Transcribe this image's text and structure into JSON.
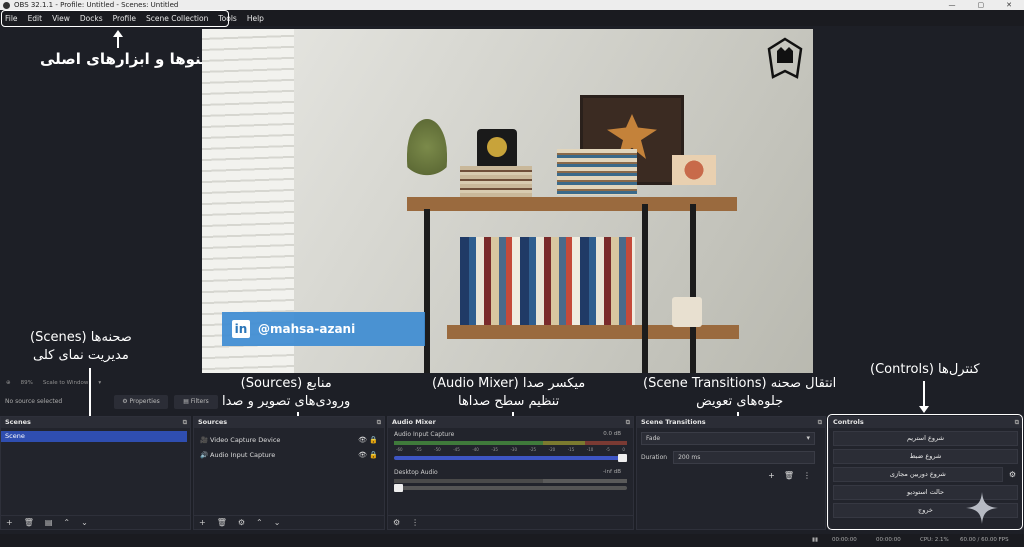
{
  "window": {
    "title": "OBS 32.1.1 - Profile: Untitled - Scenes: Untitled",
    "controls": [
      "—",
      "▢",
      "✕"
    ]
  },
  "menu": [
    "File",
    "Edit",
    "View",
    "Docks",
    "Profile",
    "Scene Collection",
    "Tools",
    "Help"
  ],
  "annotations": {
    "menu": "منوها و ابزارهای اصلی",
    "scenes": [
      "صحنه‌ها (Scenes)",
      "مدیریت نمای کلی"
    ],
    "sources": [
      "منابع (Sources)",
      "ورودی‌های تصویر و صدا"
    ],
    "mixer": [
      "میکسر صدا (Audio Mixer)",
      "تنظیم سطح صداها"
    ],
    "transitions": [
      "انتقال صحنه (Scene Transitions)",
      "جلوه‌های تعویض"
    ],
    "controls": "کنترل‌ها (Controls)"
  },
  "preview": {
    "overlay_handle": "@mahsa-azani",
    "overlay_icon": "in"
  },
  "status_row": [
    "⊕",
    "89%",
    "Scale to Window",
    "▾"
  ],
  "props_row": {
    "no_source": "No source selected",
    "properties": "⚙ Properties",
    "filters": "▤ Filters"
  },
  "scenes": {
    "title": "Scenes",
    "items": [
      "Scene"
    ]
  },
  "sources": {
    "title": "Sources",
    "items": [
      {
        "icon": "🎥",
        "name": "Video Capture Device"
      },
      {
        "icon": "🔊",
        "name": "Audio Input Capture"
      }
    ]
  },
  "mixer": {
    "title": "Audio Mixer",
    "channels": [
      {
        "name": "Audio Input Capture",
        "level": "0.0 dB",
        "active": true
      },
      {
        "name": "Desktop Audio",
        "level": "-inf dB",
        "active": false
      }
    ],
    "ticks": [
      "-60",
      "-55",
      "-50",
      "-45",
      "-40",
      "-35",
      "-30",
      "-25",
      "-20",
      "-15",
      "-10",
      "-5",
      "0"
    ]
  },
  "transitions": {
    "title": "Scene Transitions",
    "selected": "Fade",
    "duration_label": "Duration",
    "duration_value": "200 ms"
  },
  "controls": {
    "title": "Controls",
    "buttons": [
      "شروع استریم",
      "شروع ضبط",
      "شروع دوربین مجازی",
      "حالت استودیو",
      "خروج"
    ]
  },
  "dock_footer_icons": {
    "add": "+",
    "remove": "🗑",
    "gear": "⚙",
    "up": "⌃",
    "down": "⌄",
    "more": "⋮"
  },
  "bottombar": {
    "stream": "00:00:00",
    "rec": "00:00:00",
    "cpu": "CPU: 2.1%",
    "fps": "60.00 / 60.00 FPS"
  },
  "colors": {
    "accent": "#2f4eb0",
    "panel": "#22242c",
    "titlebar": "#2b2d36"
  }
}
